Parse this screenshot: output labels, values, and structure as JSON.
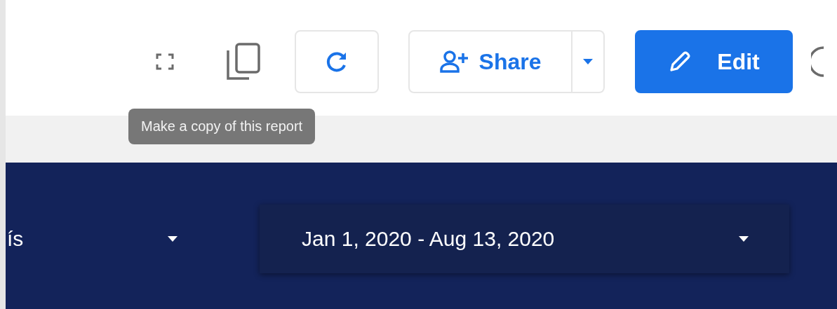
{
  "toolbar": {
    "share": {
      "label": "Share"
    },
    "edit": {
      "label": "Edit"
    }
  },
  "tooltip": {
    "text": "Make a copy of this report"
  },
  "filters": [
    {
      "value": "ís"
    },
    {
      "value": "Jan 1, 2020 - Aug 13, 2020"
    }
  ]
}
